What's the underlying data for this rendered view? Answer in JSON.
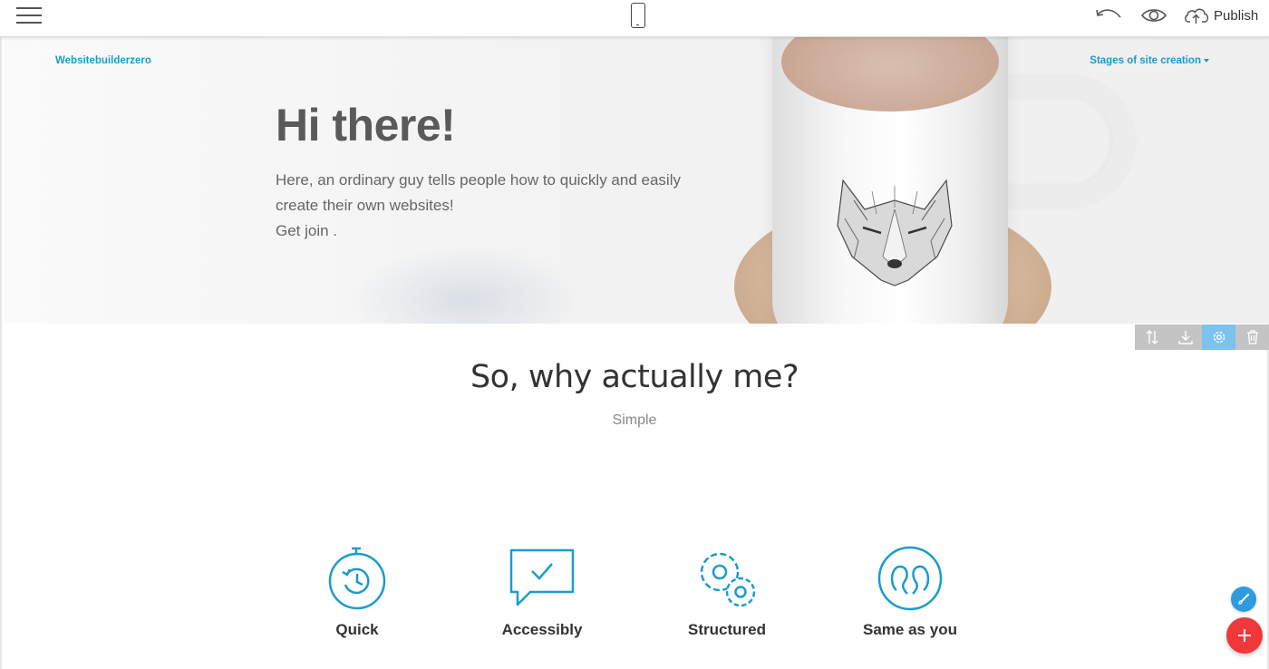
{
  "toolbar": {
    "menu_icon": "hamburger-icon",
    "device_icon": "mobile-phone-icon",
    "undo_icon": "undo-icon",
    "preview_icon": "eye-icon",
    "publish_icon": "cloud-upload-icon",
    "publish_label": "Publish"
  },
  "hero": {
    "brand": "Websitebuilderzero",
    "menu_item": "Stages of site creation",
    "title": "Hi there!",
    "text_lines": [
      "Here, an ordinary guy tells people how to quickly and easily",
      "create their own websites!",
      "Get join ."
    ]
  },
  "block_tools": [
    "reorder-icon",
    "download-icon",
    "gear-icon",
    "trash-icon"
  ],
  "section": {
    "title": "So, why actually me?",
    "subtitle": "Simple"
  },
  "features": [
    {
      "label": "Quick",
      "icon": "stopwatch-icon"
    },
    {
      "label": "Accessibly",
      "icon": "chat-check-icon"
    },
    {
      "label": "Structured",
      "icon": "gears-icon"
    },
    {
      "label": "Same as you",
      "icon": "people-icon"
    }
  ],
  "colors": {
    "accent": "#1b9ccd",
    "fab_add": "#f0383c",
    "fab_brush": "#2e9be0",
    "tool_active": "#7bc3ec"
  }
}
